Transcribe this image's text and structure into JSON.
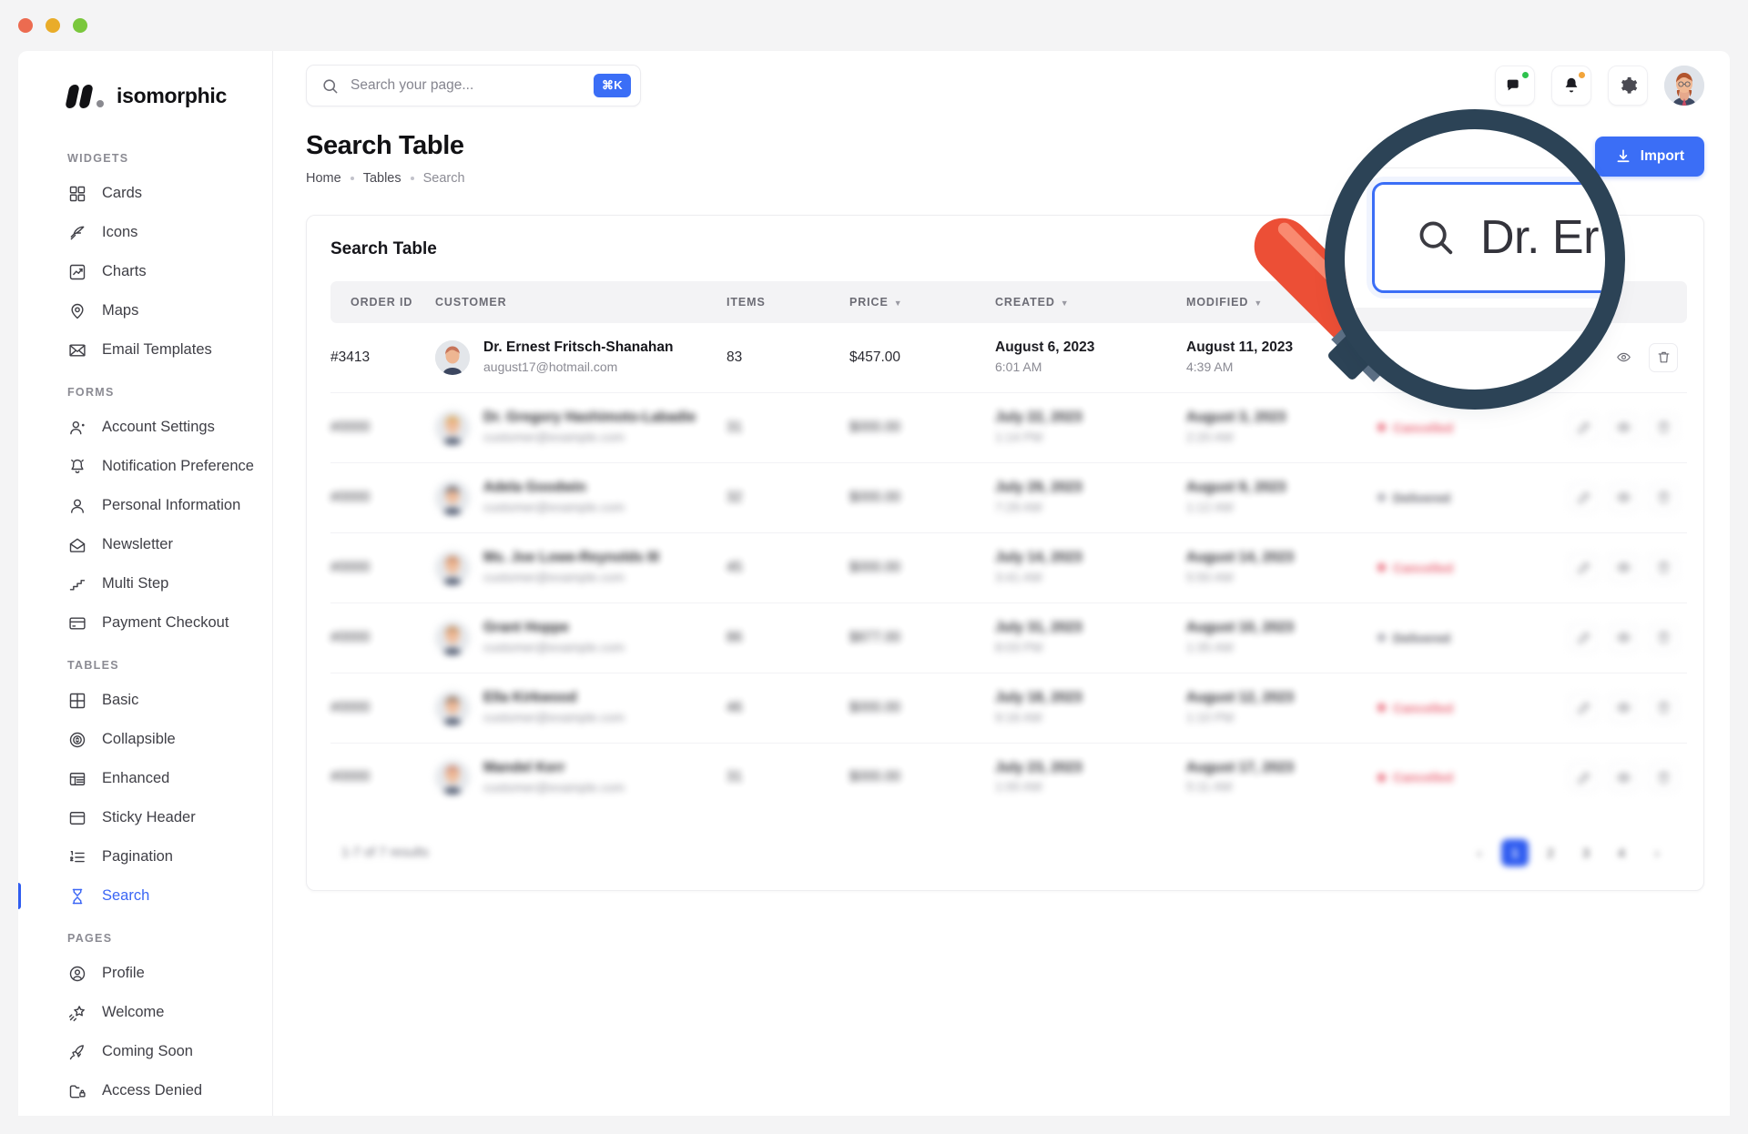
{
  "window": {
    "dots": [
      "close",
      "minimize",
      "maximize"
    ]
  },
  "brand": {
    "name": "isomorphic"
  },
  "sidebar": {
    "sections": [
      {
        "title": "WIDGETS",
        "items": [
          {
            "label": "Cards",
            "icon": "cards-icon"
          },
          {
            "label": "Icons",
            "icon": "feather-icon"
          },
          {
            "label": "Charts",
            "icon": "chart-icon"
          },
          {
            "label": "Maps",
            "icon": "map-pin-icon"
          },
          {
            "label": "Email Templates",
            "icon": "envelope-icon"
          }
        ]
      },
      {
        "title": "FORMS",
        "items": [
          {
            "label": "Account Settings",
            "icon": "user-gear-icon"
          },
          {
            "label": "Notification Preference",
            "icon": "bell-icon"
          },
          {
            "label": "Personal Information",
            "icon": "user-icon"
          },
          {
            "label": "Newsletter",
            "icon": "open-envelope-icon"
          },
          {
            "label": "Multi Step",
            "icon": "stairs-icon"
          },
          {
            "label": "Payment Checkout",
            "icon": "credit-card-icon"
          }
        ]
      },
      {
        "title": "TABLES",
        "items": [
          {
            "label": "Basic",
            "icon": "table-grid-icon"
          },
          {
            "label": "Collapsible",
            "icon": "collapse-circle-icon"
          },
          {
            "label": "Enhanced",
            "icon": "table-rows-icon"
          },
          {
            "label": "Sticky Header",
            "icon": "sticky-header-icon"
          },
          {
            "label": "Pagination",
            "icon": "ordered-list-icon"
          },
          {
            "label": "Search",
            "icon": "hourglass-icon",
            "active": true
          }
        ]
      },
      {
        "title": "PAGES",
        "items": [
          {
            "label": "Profile",
            "icon": "profile-circle-icon"
          },
          {
            "label": "Welcome",
            "icon": "shooting-star-icon"
          },
          {
            "label": "Coming Soon",
            "icon": "rocket-icon"
          },
          {
            "label": "Access Denied",
            "icon": "locked-folder-icon"
          }
        ]
      }
    ]
  },
  "topbar": {
    "search_placeholder": "Search your page...",
    "search_value": "",
    "shortcut_label": "⌘K",
    "actions": [
      {
        "name": "messages-icon",
        "badge": "green"
      },
      {
        "name": "notifications-icon",
        "badge": "orange"
      },
      {
        "name": "settings-gear-icon",
        "badge": ""
      }
    ],
    "avatar_alt": "user-avatar"
  },
  "page": {
    "title": "Search Table",
    "breadcrumb": [
      "Home",
      "Tables",
      "Search"
    ],
    "import_label": "Import"
  },
  "table": {
    "card_title": "Search Table",
    "columns": [
      {
        "label": "ORDER ID",
        "sortable": false
      },
      {
        "label": "CUSTOMER",
        "sortable": false
      },
      {
        "label": "ITEMS",
        "sortable": false
      },
      {
        "label": "PRICE",
        "sortable": true
      },
      {
        "label": "CREATED",
        "sortable": true
      },
      {
        "label": "MODIFIED",
        "sortable": true
      },
      {
        "label": "",
        "sortable": false
      },
      {
        "label": "",
        "sortable": false
      }
    ],
    "rows": [
      {
        "order_id": "#3413",
        "customer_name": "Dr. Ernest Fritsch-Shanahan",
        "customer_email": "august17@hotmail.com",
        "items": "83",
        "price": "$457.00",
        "created_date": "August 6, 2023",
        "created_time": "6:01 AM",
        "modified_date": "August 11, 2023",
        "modified_time": "4:39 AM",
        "status": "",
        "blurred": false
      },
      {
        "order_id": "#0000",
        "customer_name": "Dr. Gregory Hashimoto-Labadie",
        "customer_email": "customer@example.com",
        "items": "31",
        "price": "$000.00",
        "created_date": "July 22, 2023",
        "created_time": "1:14 PM",
        "modified_date": "August 3, 2023",
        "modified_time": "2:20 AM",
        "status": "Cancelled",
        "blurred": true
      },
      {
        "order_id": "#0000",
        "customer_name": "Adela Goodwin",
        "customer_email": "customer@example.com",
        "items": "32",
        "price": "$000.00",
        "created_date": "July 29, 2023",
        "created_time": "7:29 AM",
        "modified_date": "August 9, 2023",
        "modified_time": "1:12 AM",
        "status": "Delivered",
        "blurred": true
      },
      {
        "order_id": "#0000",
        "customer_name": "Ms. Joe Lowe-Reynolds III",
        "customer_email": "customer@example.com",
        "items": "45",
        "price": "$000.00",
        "created_date": "July 14, 2023",
        "created_time": "3:41 AM",
        "modified_date": "August 14, 2023",
        "modified_time": "5:50 AM",
        "status": "Cancelled",
        "blurred": true
      },
      {
        "order_id": "#0000",
        "customer_name": "Grant Hoppe",
        "customer_email": "customer@example.com",
        "items": "86",
        "price": "$877.00",
        "created_date": "July 31, 2023",
        "created_time": "8:03 PM",
        "modified_date": "August 10, 2023",
        "modified_time": "1:35 AM",
        "status": "Delivered",
        "blurred": true
      },
      {
        "order_id": "#0000",
        "customer_name": "Ella Kirkwood",
        "customer_email": "customer@example.com",
        "items": "46",
        "price": "$000.00",
        "created_date": "July 18, 2023",
        "created_time": "9:16 AM",
        "modified_date": "August 12, 2023",
        "modified_time": "1:10 PM",
        "status": "Cancelled",
        "blurred": true
      },
      {
        "order_id": "#0000",
        "customer_name": "Mandel Kerr",
        "customer_email": "customer@example.com",
        "items": "31",
        "price": "$000.00",
        "created_date": "July 23, 2023",
        "created_time": "1:00 AM",
        "modified_date": "August 17, 2023",
        "modified_time": "5:11 AM",
        "status": "Cancelled",
        "blurred": true
      }
    ],
    "footer_count": "1-7 of 7 results",
    "pagination": {
      "prev": "‹",
      "pages": [
        "1",
        "2",
        "3",
        "4"
      ],
      "current": "1",
      "next": "›"
    }
  },
  "magnifier": {
    "zoom_search_value": "Dr. Er",
    "clear_label": "×",
    "search_icon": "search-icon"
  },
  "colors": {
    "accent": "#3b6ef6",
    "active_nav": "#3b66f5",
    "cancelled": "#e8596b",
    "delivered": "#4c4c56",
    "lens_ring": "#2c4356",
    "handle": "#ec4f36"
  }
}
